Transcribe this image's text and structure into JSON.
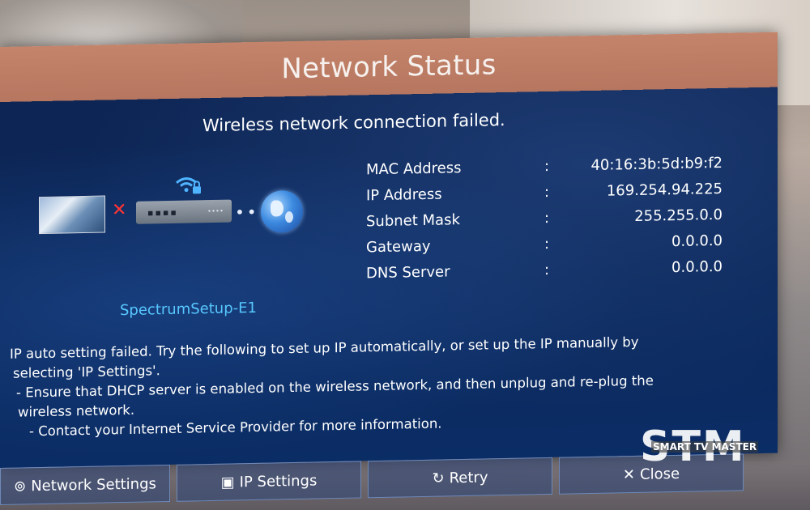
{
  "window": {
    "title": "Network Status"
  },
  "status": {
    "message": "Wireless network connection failed."
  },
  "diagram": {
    "network_name": "SpectrumSetup-E1",
    "link_failed_mark": "✕",
    "router_ports": "▪▪▪▪",
    "router_leds": "∙∙∙∙",
    "dots": "•••"
  },
  "info": {
    "separator": ":",
    "rows": [
      {
        "label": "MAC Address",
        "value": "40:16:3b:5d:b9:f2"
      },
      {
        "label": "IP Address",
        "value": "169.254.94.225"
      },
      {
        "label": "Subnet Mask",
        "value": "255.255.0.0"
      },
      {
        "label": "Gateway",
        "value": "0.0.0.0"
      },
      {
        "label": "DNS Server",
        "value": "0.0.0.0"
      }
    ]
  },
  "help": {
    "line1": "IP auto setting failed. Try the following to set up IP automatically, or set up the IP manually by",
    "line2": "selecting 'IP Settings'.",
    "line3": "- Ensure that DHCP server is enabled on the wireless network, and then unplug and re-plug the",
    "line4": "wireless network.",
    "line5": "- Contact your Internet Service Provider for more information."
  },
  "buttons": {
    "network_settings": "Network Settings",
    "ip_settings": "IP Settings",
    "retry": "Retry",
    "close": "Close"
  },
  "icons": {
    "network_settings_icon": "wifi-settings-icon",
    "ip_settings_icon": "ip-card-icon",
    "retry_icon": "refresh-icon",
    "close_icon": "close-icon"
  },
  "watermark": {
    "big": "STM",
    "small": "SMART TV MASTER"
  },
  "colors": {
    "title_bar": "#b97862",
    "panel": "#0b2a60",
    "network_name": "#57c8ff",
    "fail_mark": "#ff3434"
  }
}
